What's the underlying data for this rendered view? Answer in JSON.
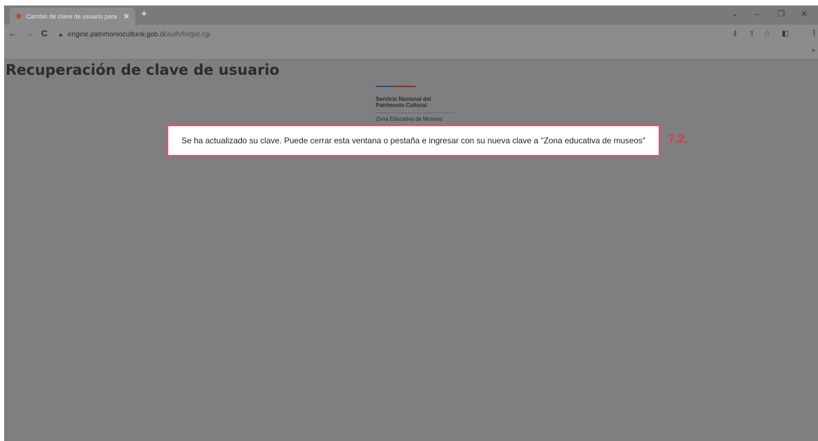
{
  "browser": {
    "tab_title": "Cambio de clave de usuario para",
    "tab_close": "✕",
    "new_tab": "+",
    "url_host": "engine.patrimoniocultural.gob.cl",
    "url_path": "/auth/forgot.cgi",
    "bookmarks_overflow": "»",
    "window_controls": {
      "dropdown": "⌄",
      "minimize": "–",
      "restore": "❐",
      "close": "✕"
    },
    "toolbar_icons": [
      "key-icon",
      "share-icon",
      "star-icon",
      "sidebar-icon",
      "menu-icon"
    ]
  },
  "page": {
    "title": "Recuperación de clave de usuario",
    "logo": {
      "org_line1": "Servicio Nacional del",
      "org_line2": "Patrimonio Cultural",
      "subtitle": "Zona Educativa de Museos",
      "stripe_colors": [
        "#2d4a7a",
        "#8a2a2a"
      ]
    },
    "message": "Se ha actualizado su clave. Puede cerrar esta ventana o pestaña e ingresar con su nueva clave a \"Zona educativa de museos\"",
    "step_label": "7.2.",
    "highlight_color": "#e8506a",
    "step_color": "#e5383b"
  }
}
